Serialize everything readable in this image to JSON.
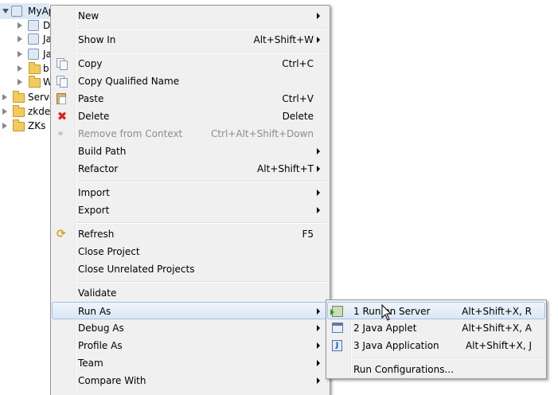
{
  "tree": {
    "rows": [
      {
        "label": "MyAp",
        "expanded": true,
        "icon": "project-icon"
      },
      {
        "label": "D",
        "icon": "library-icon"
      },
      {
        "label": "Ja",
        "icon": "java-resources-icon"
      },
      {
        "label": "Ja",
        "icon": "java-libs-icon"
      },
      {
        "label": "b",
        "icon": "folder-icon"
      },
      {
        "label": "W",
        "icon": "folder-icon"
      },
      {
        "label": "Server",
        "icon": "folder-icon"
      },
      {
        "label": "zkder",
        "icon": "folder-icon"
      },
      {
        "label": "ZKs",
        "icon": "folder-icon"
      }
    ]
  },
  "menu": {
    "items": [
      {
        "label": "New",
        "shortcut": "",
        "submenu": true
      },
      {
        "label": "Show In",
        "shortcut": "Alt+Shift+W",
        "submenu": true
      },
      {
        "label": "Copy",
        "shortcut": "Ctrl+C",
        "icon": "copy-icon"
      },
      {
        "label": "Copy Qualified Name",
        "shortcut": "",
        "icon": "copy-qualified-icon"
      },
      {
        "label": "Paste",
        "shortcut": "Ctrl+V",
        "icon": "paste-icon"
      },
      {
        "label": "Delete",
        "shortcut": "Delete",
        "icon": "delete-icon"
      },
      {
        "label": "Remove from Context",
        "shortcut": "Ctrl+Alt+Shift+Down",
        "disabled": true,
        "icon": "remove-context-icon"
      },
      {
        "label": "Build Path",
        "shortcut": "",
        "submenu": true
      },
      {
        "label": "Refactor",
        "shortcut": "Alt+Shift+T",
        "submenu": true
      },
      {
        "label": "Import",
        "shortcut": "",
        "submenu": true
      },
      {
        "label": "Export",
        "shortcut": "",
        "submenu": true
      },
      {
        "label": "Refresh",
        "shortcut": "F5",
        "icon": "refresh-icon"
      },
      {
        "label": "Close Project",
        "shortcut": ""
      },
      {
        "label": "Close Unrelated Projects",
        "shortcut": ""
      },
      {
        "label": "Validate",
        "shortcut": ""
      },
      {
        "label": "Run As",
        "shortcut": "",
        "submenu": true,
        "highlighted": true
      },
      {
        "label": "Debug As",
        "shortcut": "",
        "submenu": true
      },
      {
        "label": "Profile As",
        "shortcut": "",
        "submenu": true
      },
      {
        "label": "Team",
        "shortcut": "",
        "submenu": true
      },
      {
        "label": "Compare With",
        "shortcut": "",
        "submenu": true
      }
    ]
  },
  "submenu": {
    "items": [
      {
        "label": "1 Run on Server",
        "shortcut": "Alt+Shift+X, R",
        "icon": "run-on-server-icon",
        "highlighted": true
      },
      {
        "label": "2 Java Applet",
        "shortcut": "Alt+Shift+X, A",
        "icon": "java-applet-icon"
      },
      {
        "label": "3 Java Application",
        "shortcut": "Alt+Shift+X, J",
        "icon": "java-application-icon"
      },
      {
        "label": "Run Configurations...",
        "shortcut": ""
      }
    ]
  },
  "colors": {
    "menu_bg": "#f0f0f0",
    "highlight_border": "#a7c1e2",
    "disabled_text": "#8d8d8d",
    "delete_icon": "#dd2222"
  }
}
